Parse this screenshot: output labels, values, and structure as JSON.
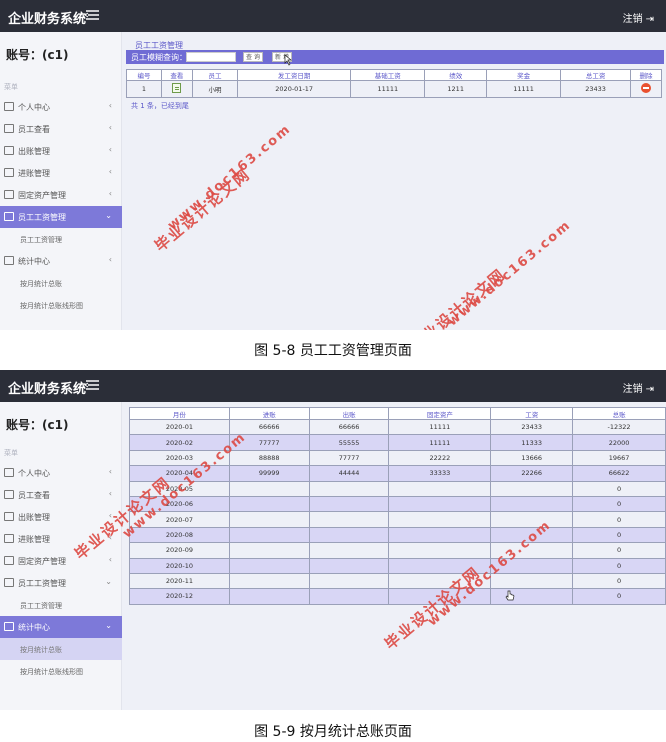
{
  "app": {
    "title": "企业财务系统",
    "logout_label": "注销",
    "account_label": "账号：(c1)",
    "nav_header": "菜单"
  },
  "screen1": {
    "nav": [
      {
        "label": "个人中心",
        "chevron": "‹"
      },
      {
        "label": "员工查看",
        "chevron": "‹"
      },
      {
        "label": "出账管理",
        "chevron": "‹"
      },
      {
        "label": "进账管理",
        "chevron": "‹"
      },
      {
        "label": "固定资产管理",
        "chevron": "‹"
      },
      {
        "label": "员工工资管理",
        "chevron": "⌄"
      },
      {
        "label": "员工工资管理"
      },
      {
        "label": "统计中心",
        "chevron": "‹"
      },
      {
        "label": "按月统计总账"
      },
      {
        "label": "按月统计总账线形图"
      }
    ],
    "panel_title": "员工工资管理",
    "search_label": "员工模糊查询：",
    "search_value": "",
    "search_button": "查 询",
    "add_button": "新 增",
    "columns": [
      "编号",
      "查看",
      "员工",
      "发工资日期",
      "基础工资",
      "绩效",
      "奖金",
      "总工资",
      "删除"
    ],
    "rows": [
      {
        "id": "1",
        "employee": "小明",
        "date": "2020-01-17",
        "base": "11111",
        "perf": "1211",
        "bonus": "11111",
        "total": "23433"
      }
    ],
    "paging": "共 1 条，已经到尾"
  },
  "screen2": {
    "nav": [
      {
        "label": "个人中心",
        "chevron": "‹"
      },
      {
        "label": "员工查看",
        "chevron": "‹"
      },
      {
        "label": "出账管理",
        "chevron": "‹"
      },
      {
        "label": "进账管理",
        "chevron": "‹"
      },
      {
        "label": "固定资产管理",
        "chevron": "‹"
      },
      {
        "label": "员工工资管理",
        "chevron": "⌄"
      },
      {
        "label": "员工工资管理"
      },
      {
        "label": "统计中心",
        "chevron": "⌄"
      },
      {
        "label": "按月统计总账"
      },
      {
        "label": "按月统计总账线形图"
      }
    ],
    "columns": [
      "月份",
      "进账",
      "出账",
      "固定资产",
      "工资",
      "总账"
    ],
    "rows": [
      [
        "2020-01",
        "66666",
        "66666",
        "11111",
        "23433",
        "-12322"
      ],
      [
        "2020-02",
        "77777",
        "55555",
        "11111",
        "11333",
        "22000"
      ],
      [
        "2020-03",
        "88888",
        "77777",
        "22222",
        "13666",
        "19667"
      ],
      [
        "2020-04",
        "99999",
        "44444",
        "33333",
        "22266",
        "66622"
      ],
      [
        "2020-05",
        "",
        "",
        "",
        "",
        "0"
      ],
      [
        "2020-06",
        "",
        "",
        "",
        "",
        "0"
      ],
      [
        "2020-07",
        "",
        "",
        "",
        "",
        "0"
      ],
      [
        "2020-08",
        "",
        "",
        "",
        "",
        "0"
      ],
      [
        "2020-09",
        "",
        "",
        "",
        "",
        "0"
      ],
      [
        "2020-10",
        "",
        "",
        "",
        "",
        "0"
      ],
      [
        "2020-11",
        "",
        "",
        "",
        "",
        "0"
      ],
      [
        "2020-12",
        "",
        "",
        "",
        "",
        "0"
      ]
    ]
  },
  "captions": {
    "fig1": "图 5-8 员工工资管理页面",
    "fig2": "图 5-9 按月统计总账页面"
  },
  "watermarks": {
    "site": "www.doc163.com",
    "brand": "毕业设计论文网"
  },
  "colors": {
    "topbar": "#2b2e38",
    "accent": "#7d79d9",
    "sub_active": "#d5d4f3",
    "delete": "#e9502f",
    "watermark": "#dd4a44"
  }
}
